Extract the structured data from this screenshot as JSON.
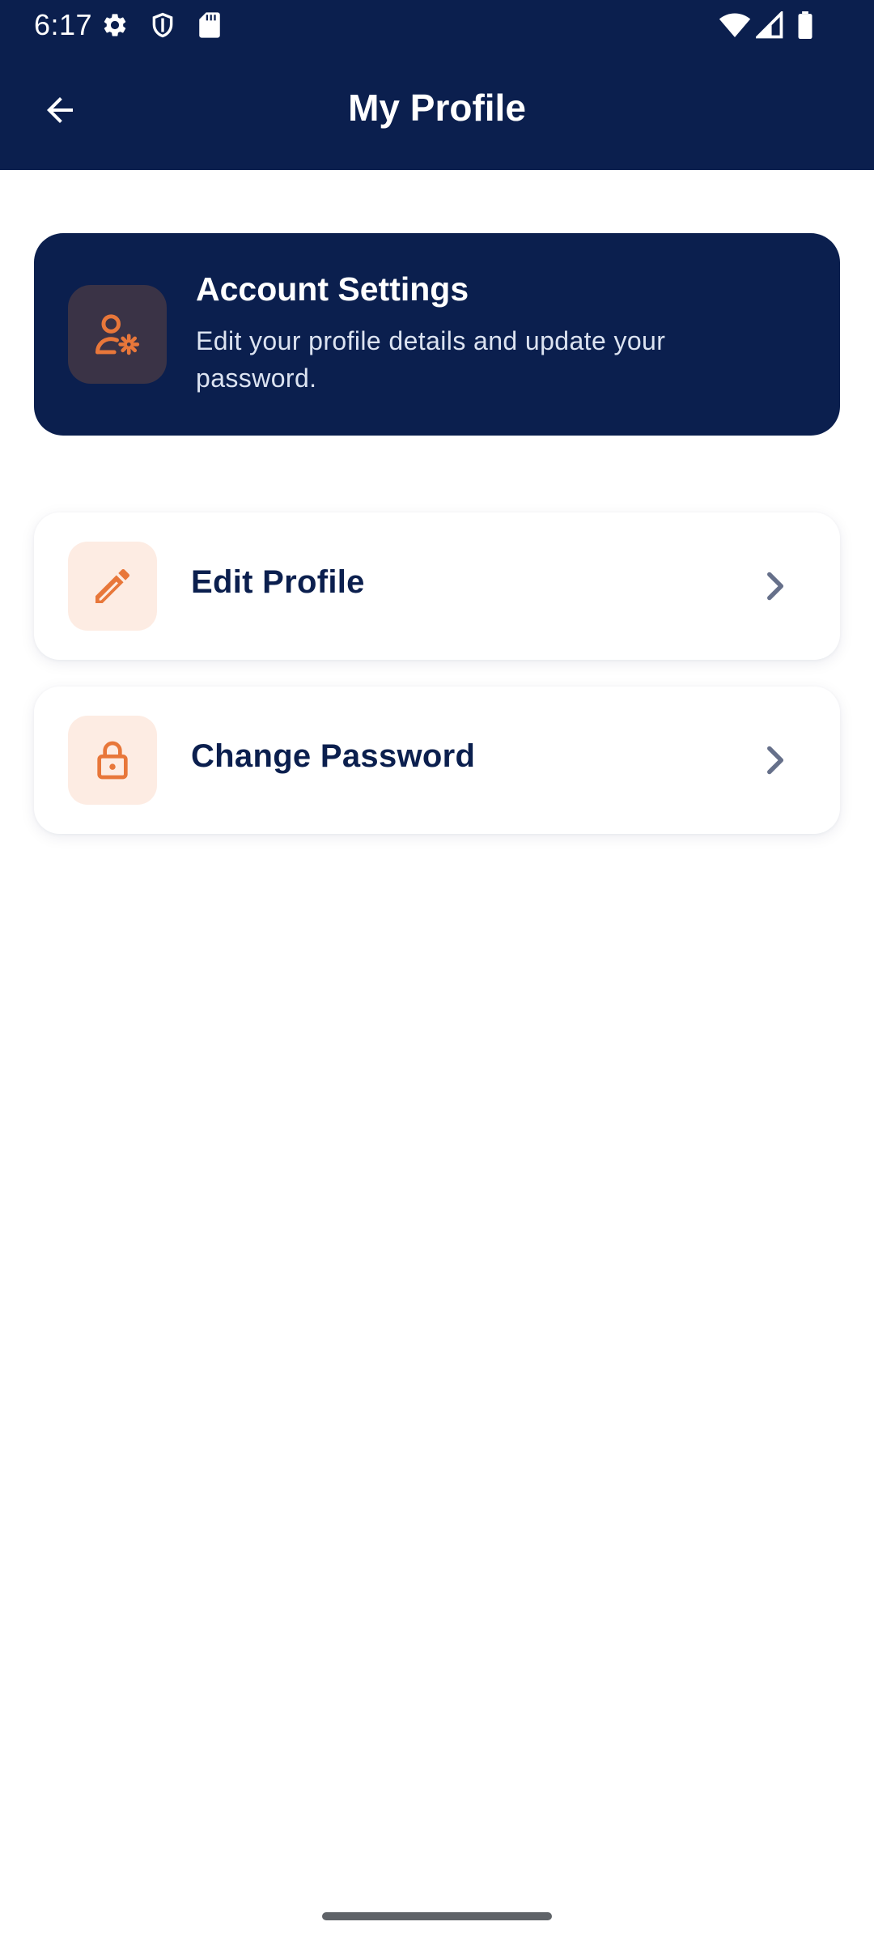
{
  "status_bar": {
    "time": "6:17",
    "icons_left": [
      "gear-icon",
      "shield-icon",
      "sd-card-icon"
    ],
    "icons_right": [
      "wifi-icon",
      "signal-icon",
      "battery-icon"
    ]
  },
  "app_bar": {
    "title": "My Profile",
    "back_icon": "arrow-left-icon"
  },
  "account_card": {
    "title": "Account Settings",
    "description": "Edit your profile details and update your password.",
    "icon": "user-gear-icon"
  },
  "menu": {
    "items": [
      {
        "label": "Edit Profile",
        "icon": "pencil-icon"
      },
      {
        "label": "Change Password",
        "icon": "lock-icon"
      }
    ]
  },
  "colors": {
    "primary_navy": "#0b1f4e",
    "accent_orange": "#e8773a",
    "icon_bg_light": "#fdece3",
    "icon_bg_dark": "#3a3346",
    "chevron_gray": "#66708a"
  }
}
